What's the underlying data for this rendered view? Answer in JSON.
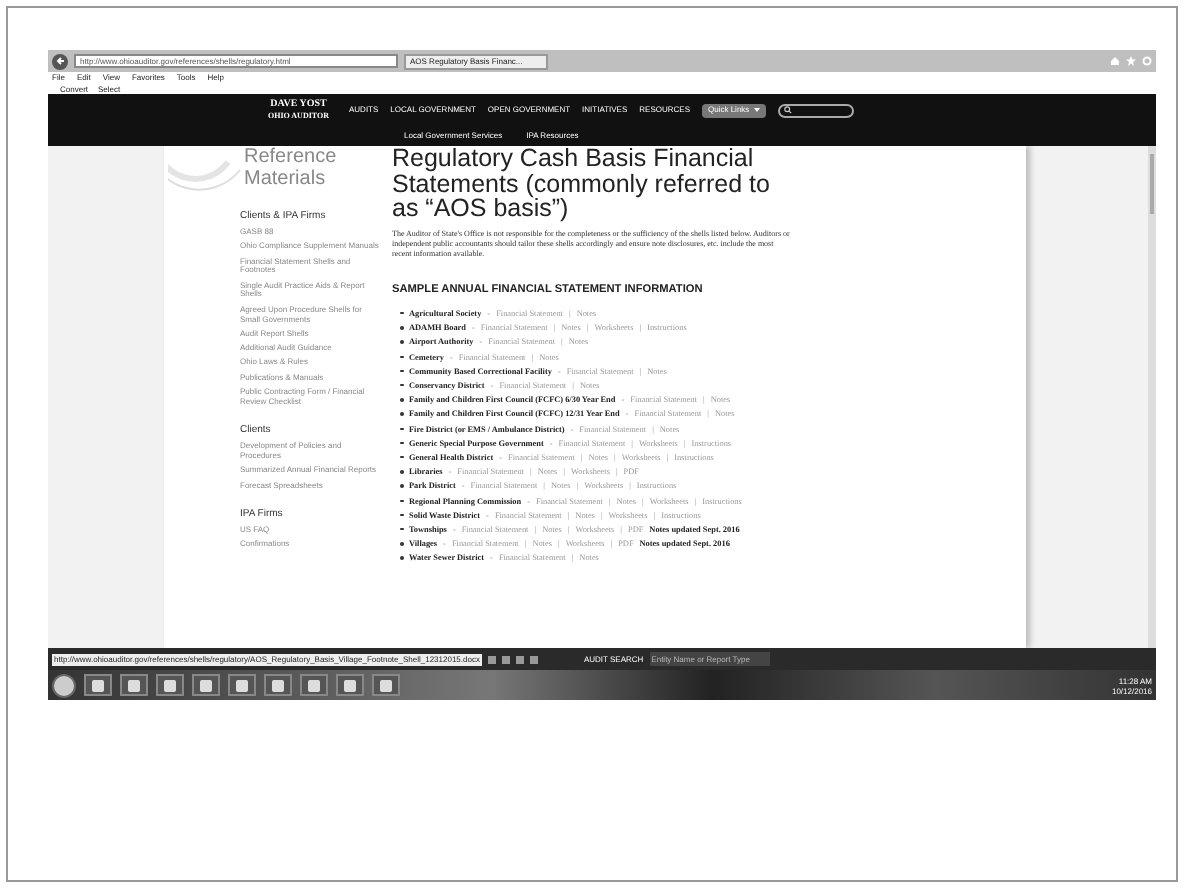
{
  "browser": {
    "address": "http://www.ohioauditor.gov/references/shells/regulatory.html",
    "tab": "AOS Regulatory Basis Financ...",
    "menu": [
      "File",
      "Edit",
      "View",
      "Favorites",
      "Tools",
      "Help"
    ],
    "commands": [
      "Convert",
      "Select"
    ]
  },
  "header": {
    "logo_top": "DAVE YOST",
    "logo_bottom": "OHIO AUDITOR",
    "nav": [
      "AUDITS",
      "LOCAL GOVERNMENT",
      "OPEN GOVERNMENT",
      "INITIATIVES",
      "RESOURCES"
    ],
    "quick_links": "Quick Links",
    "subnav": [
      "Local Government Services",
      "IPA Resources"
    ]
  },
  "sidebar": {
    "title": "Reference Materials",
    "sections": [
      {
        "heading": "Clients & IPA Firms",
        "items": [
          "GASB 88",
          "Ohio Compliance Supplement Manuals",
          "Financial Statement Shells and Footnotes",
          "Single Audit Practice Aids & Report Shells",
          "Agreed Upon Procedure Shells for Small Governments",
          "Audit Report Shells",
          "Additional Audit Guidance",
          "Ohio Laws & Rules",
          "Publications & Manuals",
          "Public Contracting Form / Financial Review Checklist"
        ]
      },
      {
        "heading": "Clients",
        "items": [
          "Development of Policies and Procedures",
          "Summarized Annual Financial Reports",
          "Forecast Spreadsheets"
        ]
      },
      {
        "heading": "IPA Firms",
        "items": [
          "US FAQ",
          "Confirmations"
        ]
      }
    ]
  },
  "main": {
    "title": "Regulatory Cash Basis Financial Statements (commonly referred to as “AOS basis”)",
    "intro": "The Auditor of State's Office is not responsible for the completeness or the sufficiency of the shells listed below. Auditors or independent public accountants should tailor these shells accordingly and ensure note disclosures, etc. include the most recent information available.",
    "section_heading": "SAMPLE ANNUAL FINANCIAL STATEMENT INFORMATION",
    "dash": "-",
    "pipe": "|",
    "entries": [
      {
        "name": "Agricultural Society",
        "links": [
          "Financial Statement",
          "Notes"
        ]
      },
      {
        "name": "ADAMH Board",
        "links": [
          "Financial Statement",
          "Notes",
          "Worksheets",
          "Instructions"
        ]
      },
      {
        "name": "Airport Authority",
        "links": [
          "Financial Statement",
          "Notes"
        ]
      },
      {
        "name": "Cemetery",
        "links": [
          "Financial Statement",
          "Notes"
        ]
      },
      {
        "name": "Community Based Correctional Facility",
        "links": [
          "Financial Statement",
          "Notes"
        ]
      },
      {
        "name": "Conservancy District",
        "links": [
          "Financial Statement",
          "Notes"
        ]
      },
      {
        "name": "Family and Children First Council (FCFC) 6/30 Year End",
        "links": [
          "Financial Statement",
          "Notes"
        ]
      },
      {
        "name": "Family and Children First Council (FCFC) 12/31 Year End",
        "links": [
          "Financial Statement",
          "Notes"
        ]
      },
      {
        "name": "Fire District (or EMS / Ambulance District)",
        "links": [
          "Financial Statement",
          "Notes"
        ]
      },
      {
        "name": "Generic Special Purpose Government",
        "links": [
          "Financial Statement",
          "Worksheets",
          "Instructions"
        ]
      },
      {
        "name": "General Health District",
        "links": [
          "Financial Statement",
          "Notes",
          "Worksheets",
          "Instructions"
        ]
      },
      {
        "name": "Libraries",
        "links": [
          "Financial Statement",
          "Notes",
          "Worksheets",
          "PDF"
        ]
      },
      {
        "name": "Park District",
        "links": [
          "Financial Statement",
          "Notes",
          "Worksheets",
          "Instructions"
        ]
      },
      {
        "name": "Regional Planning Commission",
        "links": [
          "Financial Statement",
          "Notes",
          "Worksheets",
          "Instructions"
        ]
      },
      {
        "name": "Solid Waste District",
        "links": [
          "Financial Statement",
          "Notes",
          "Worksheets",
          "Instructions"
        ]
      },
      {
        "name": "Townships",
        "links": [
          "Financial Statement",
          "Notes",
          "Worksheets",
          "PDF"
        ],
        "note": "Notes updated Sept. 2016"
      },
      {
        "name": "Villages",
        "links": [
          "Financial Statement",
          "Notes",
          "Worksheets",
          "PDF"
        ],
        "note": "Notes updated Sept. 2016"
      },
      {
        "name": "Water Sewer District",
        "links": [
          "Financial Statement",
          "Notes"
        ]
      }
    ]
  },
  "status_bar": {
    "url": "http://www.ohioauditor.gov/references/shells/regulatory/AOS_Regulatory_Basis_Village_Footnote_Shell_12312015.docx",
    "search_label": "AUDIT SEARCH",
    "search_placeholder": "Entity Name or Report Type"
  },
  "taskbar": {
    "time": "11:28 AM",
    "date": "10/12/2016"
  }
}
